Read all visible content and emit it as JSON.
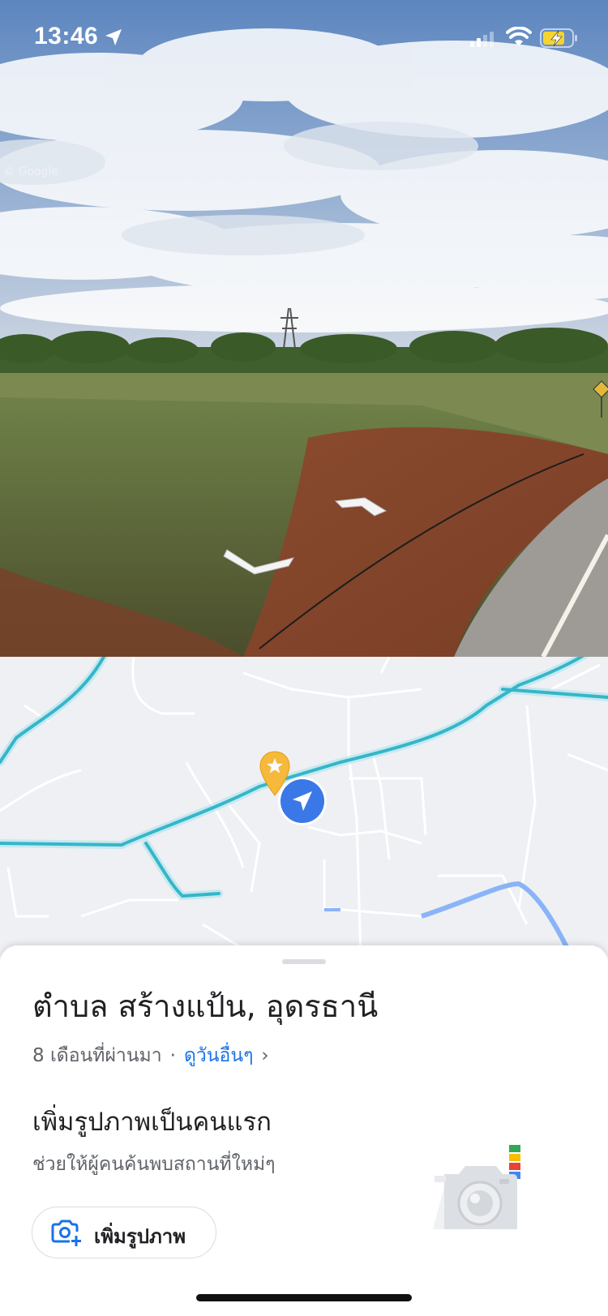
{
  "status_bar": {
    "time": "13:46"
  },
  "streetview": {
    "watermark": "© Google"
  },
  "place": {
    "title": "ตำบล สร้างแป้น, อุดรธานี",
    "age": "8 เดือนที่ผ่านมา",
    "separator": "·",
    "see_other_dates": "ดูวันอื่นๆ",
    "chevron": "›"
  },
  "add_photo": {
    "title": "เพิ่มรูปภาพเป็นคนแรก",
    "subtitle": "ช่วยให้ผู้คนค้นพบสถานที่ใหม่ๆ",
    "button_label": "เพิ่มรูปภาพ"
  },
  "colors": {
    "accent": "#1a73e8",
    "road": "#35b6c9",
    "pin": "#f6b93b",
    "map_bg": "#eef0f4"
  },
  "icons": [
    "location-arrow-icon",
    "signal-icon",
    "wifi-icon",
    "battery-charging-icon",
    "star-pin-icon",
    "my-location-icon",
    "add-photo-icon",
    "camera-illustration"
  ]
}
